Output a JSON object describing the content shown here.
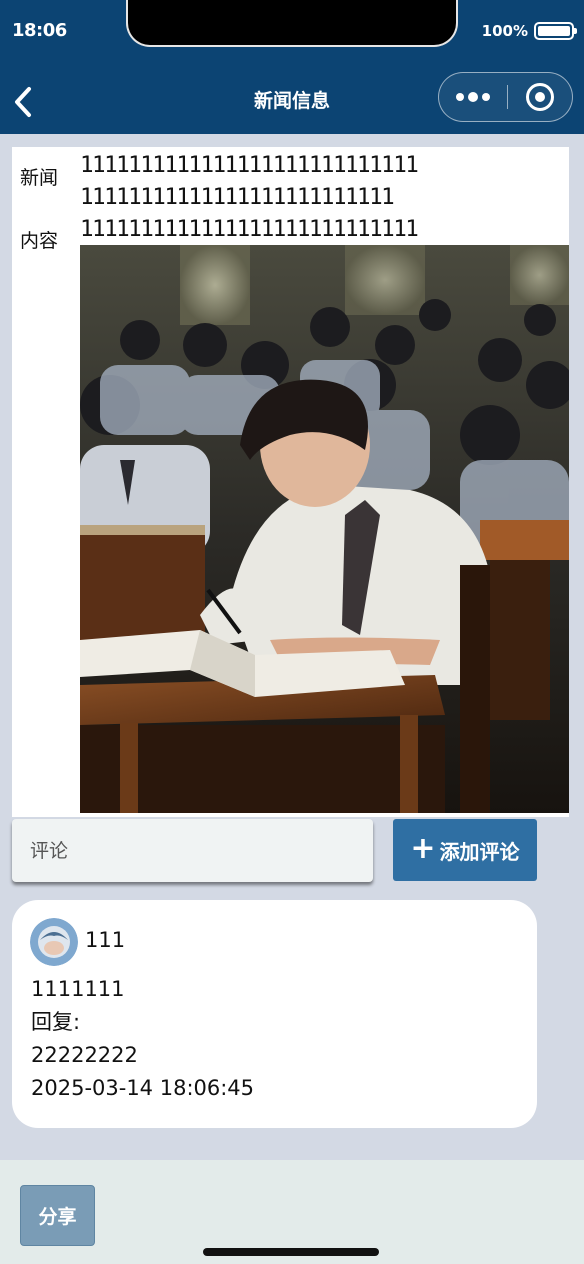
{
  "status_bar": {
    "time": "18:06",
    "battery": "100%"
  },
  "nav": {
    "title": "新闻信息",
    "back_icon": "chevron-left-icon",
    "more_icon": "more-dots-icon",
    "close_icon": "target-close-icon"
  },
  "news": {
    "label_line1": "新闻",
    "label_line2": "内容",
    "content_lines": [
      "1111111111111111111111111111",
      "11111111111111111111111111",
      "1111111111111111111111111111"
    ],
    "image_icon": "classroom-photo"
  },
  "comment_form": {
    "placeholder": "评论",
    "add_button_label": "添加评论",
    "add_icon": "plus-icon"
  },
  "comments": [
    {
      "user": "111",
      "content": "1111111",
      "reply_label": "回复:",
      "reply": "22222222",
      "time": "2025-03-14 18:06:45"
    }
  ],
  "footer": {
    "share_label": "分享"
  },
  "colors": {
    "header": "#0c4473",
    "page_bg": "#d3d9e4",
    "accent": "#2f6fa3",
    "share": "#7a9cb6"
  }
}
